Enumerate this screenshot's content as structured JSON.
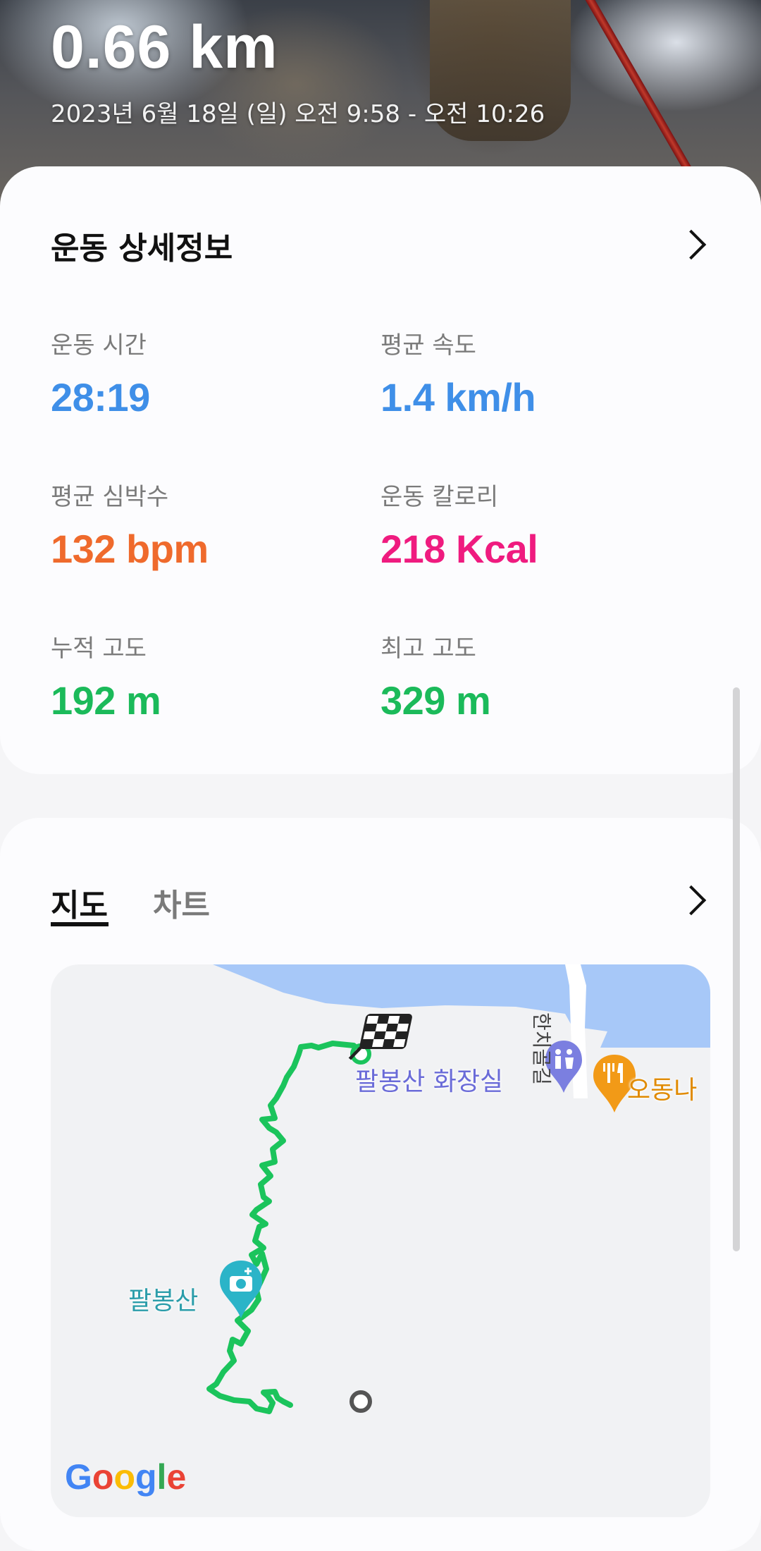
{
  "hero": {
    "distance": "0.66 km",
    "date_time": "2023년 6월 18일 (일) 오전 9:58 - 오전 10:26"
  },
  "details": {
    "title": "운동 상세정보",
    "stats": [
      {
        "label": "운동 시간",
        "value": "28:19",
        "color": "#3f8fe8"
      },
      {
        "label": "평균 속도",
        "value": "1.4 km/h",
        "color": "#3f8fe8"
      },
      {
        "label": "평균 심박수",
        "value": "132 bpm",
        "color": "#ef6a2c"
      },
      {
        "label": "운동 칼로리",
        "value": "218 Kcal",
        "color": "#ef1b7f"
      },
      {
        "label": "누적 고도",
        "value": "192 m",
        "color": "#1bba5a"
      },
      {
        "label": "최고 고도",
        "value": "329 m",
        "color": "#1bba5a"
      }
    ]
  },
  "map_section": {
    "tabs": [
      {
        "label": "지도",
        "selected": true
      },
      {
        "label": "차트",
        "selected": false
      }
    ],
    "map": {
      "road_label": "한치골길",
      "poi_restroom": "팔봉산 화장실",
      "poi_restaurant": "오동나",
      "poi_peak": "팔봉산",
      "attribution": "Google",
      "route_color": "#1bc45c",
      "water_color": "#a7c8f8"
    }
  }
}
